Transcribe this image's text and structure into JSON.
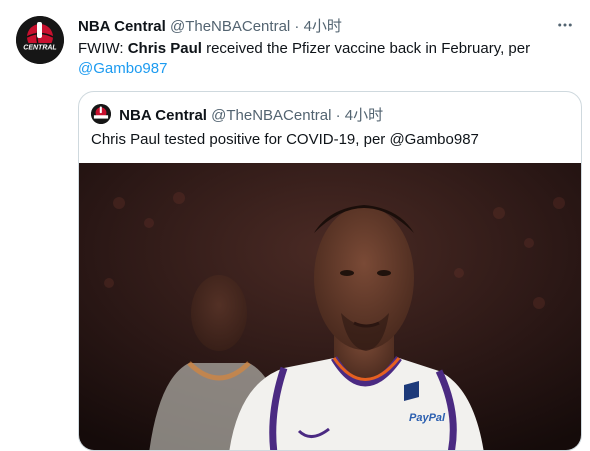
{
  "tweet": {
    "author_name": "NBA Central",
    "author_handle": "@TheNBACentral",
    "separator": "·",
    "time": "4小时",
    "text_prefix": "FWIW: ",
    "text_bold": "Chris Paul",
    "text_rest": " received the Pfizer vaccine back in February, per ",
    "text_mention": "@Gambo987"
  },
  "quote": {
    "author_name": "NBA Central",
    "author_handle": "@TheNBACentral",
    "separator": "·",
    "time": "4小时",
    "text": "Chris Paul tested positive for COVID-19, per @Gambo987"
  },
  "avatar": {
    "logo_text": "CENTRAL"
  },
  "jersey": {
    "sponsor_text": "PayPal"
  },
  "icons": {
    "more": "more-horizontal-icon"
  },
  "colors": {
    "accent": "#1d9bf0",
    "border": "#cfd9de",
    "secondary": "#536471"
  }
}
